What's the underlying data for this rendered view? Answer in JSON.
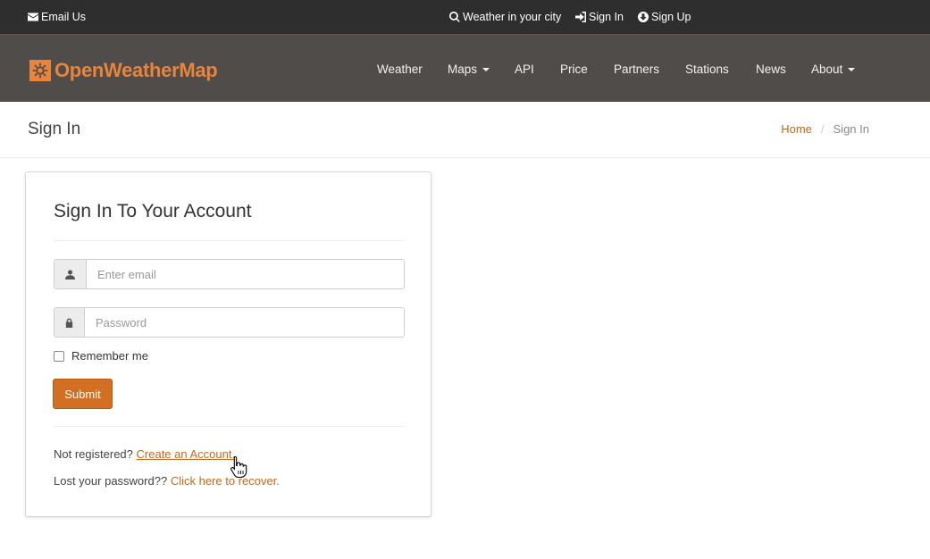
{
  "topbar": {
    "email_us": "Email Us",
    "weather_in_city": "Weather in your city",
    "sign_in": "Sign In",
    "sign_up": "Sign Up",
    "icons": [
      "envelope-icon",
      "search-icon",
      "sign-in-icon",
      "arrow-circle-down-icon"
    ]
  },
  "navbar": {
    "logo_text": "OpenWeatherMap",
    "items": [
      {
        "label": "Weather"
      },
      {
        "label": "Maps"
      },
      {
        "label": "API"
      },
      {
        "label": "Price"
      },
      {
        "label": "Partners"
      },
      {
        "label": "Stations"
      },
      {
        "label": "News"
      },
      {
        "label": "About"
      }
    ]
  },
  "page_header": {
    "title": "Sign In",
    "breadcrumb": {
      "home": "Home",
      "separator": "/",
      "current": "Sign In"
    }
  },
  "signin_form": {
    "title": "Sign In To Your Account",
    "email_placeholder": "Enter email",
    "email_value": "",
    "password_placeholder": "Password",
    "password_value": "",
    "remember_label": "Remember me",
    "remember_checked": false,
    "submit_label": "Submit",
    "not_registered_text": "Not registered?",
    "create_account_link": "Create an Account.",
    "lost_password_text": "Lost your password??",
    "recover_link": "Click here to recover."
  },
  "colors": {
    "topbar_bg": "#2e2e2e",
    "navbar_bg": "#4f4c4a",
    "brand_orange": "#e8843b",
    "button_orange": "#d36f22",
    "link_orange": "#c36a1e"
  }
}
